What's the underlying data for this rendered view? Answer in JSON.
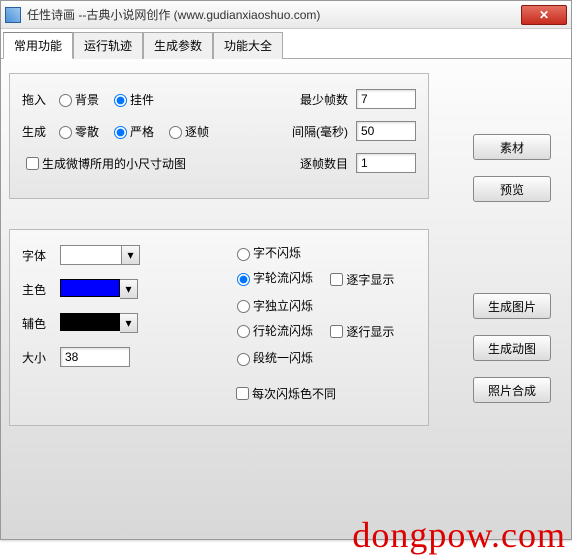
{
  "window": {
    "title": "任性诗画 --古典小说网创作 (www.gudianxiaoshuo.com)"
  },
  "tabs": [
    "常用功能",
    "运行轨迹",
    "生成参数",
    "功能大全"
  ],
  "panel1": {
    "row1": {
      "label": "拖入",
      "opt1": "背景",
      "opt2": "挂件"
    },
    "row2": {
      "label": "生成",
      "opt1": "零散",
      "opt2": "严格",
      "opt3": "逐帧"
    },
    "chk": "生成微博所用的小尺寸动图",
    "f1": {
      "label": "最少帧数",
      "value": "7"
    },
    "f2": {
      "label": "间隔(毫秒)",
      "value": "50"
    },
    "f3": {
      "label": "逐帧数目",
      "value": "1"
    }
  },
  "panel2": {
    "font": "字体",
    "main_color": "主色",
    "aux_color": "辅色",
    "size": "大小",
    "size_value": "38",
    "r1": "字不闪烁",
    "r2": "字轮流闪烁",
    "c2": "逐字显示",
    "r3": "字独立闪烁",
    "r4": "行轮流闪烁",
    "c4": "逐行显示",
    "r5": "段统一闪烁",
    "cbottom": "每次闪烁色不同"
  },
  "buttons": {
    "sucai": "素材",
    "yulan": "预览",
    "tupian": "生成图片",
    "dongtu": "生成动图",
    "hecheng": "照片合成"
  },
  "colors": {
    "main": "#0000ff",
    "aux": "#000000"
  },
  "watermark": "dongpow.com"
}
